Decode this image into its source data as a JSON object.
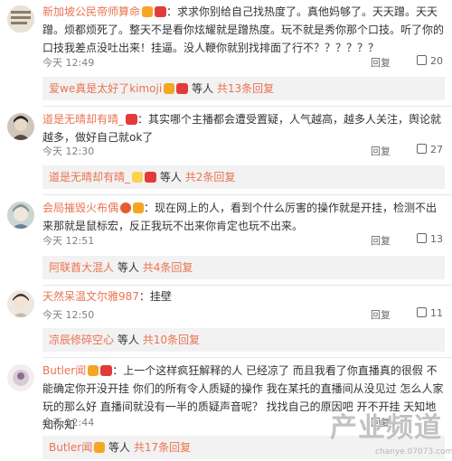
{
  "comments": [
    {
      "username": "新加坡公民帝师算命",
      "sep": "：",
      "text": "求求你别给自己找热度了。真他妈够了。天天蹭。天天蹭。烦都烦死了。整天不是看你炫耀就是蹭热度。玩不就是秀你那个口技。听了你的口技我差点没吐出来！挂逼。没人鞭你就别找排面了行不？？？？？？",
      "time": "今天 12:49",
      "reply": "回复",
      "likes": "20",
      "sub": {
        "user": "爱we真是太好了kimoji",
        "mid": "等人",
        "count": "共13条回复"
      }
    },
    {
      "username": "道是无晴却有晴_",
      "sep": "：",
      "text": "其实哪个主播都会遭受置疑，人气越高，越多人关注，舆论就越多，做好自己就ok了",
      "time": "今天 12:30",
      "reply": "回复",
      "likes": "27",
      "sub": {
        "user": "道是无晴却有晴_",
        "mid": "等人",
        "count": "共2条回复"
      }
    },
    {
      "username": "会局摧毁火布偶",
      "sep": "：",
      "text": "现在网上的人，看到个什么厉害的操作就是开挂，检测不出来那就是鼠标宏，反正我玩不出来你肯定也玩不出来。",
      "time": "今天 12:51",
      "reply": "回复",
      "likes": "13",
      "sub": {
        "user": "阿联酋大混人",
        "mid": "等人",
        "count": "共4条回复"
      }
    },
    {
      "username": "天然呆温文尔雅987",
      "sep": "：",
      "text": "挂壁",
      "time": "今天 12:50",
      "reply": "回复",
      "likes": "11",
      "sub": {
        "user": "凉辰修碎空心",
        "mid": "等人",
        "count": "共10条回复"
      }
    },
    {
      "username": "Butler闻",
      "sep": "：",
      "text": "上一个这样疯狂解释的人 已经凉了 而且我看了你直播真的很假 不能确定你开没开挂 你们的所有令人质疑的操作 我在某托的直播间从没见过 怎么人家玩的那么好 直播间就没有一半的质疑声音呢？ 找找自己的原因吧 开不开挂 天知地知你知",
      "time": "今天 12:44",
      "reply": "回复",
      "likes": "",
      "sub": {
        "user": "Butler闻",
        "mid": "等人",
        "count": "共17条回复"
      }
    }
  ],
  "watermark": {
    "big": "产业频道",
    "small": "chanye.07073.com"
  },
  "colors": {
    "username": "#eb7350",
    "meta": "#808080",
    "sub_bg": "#f2f2f2"
  }
}
